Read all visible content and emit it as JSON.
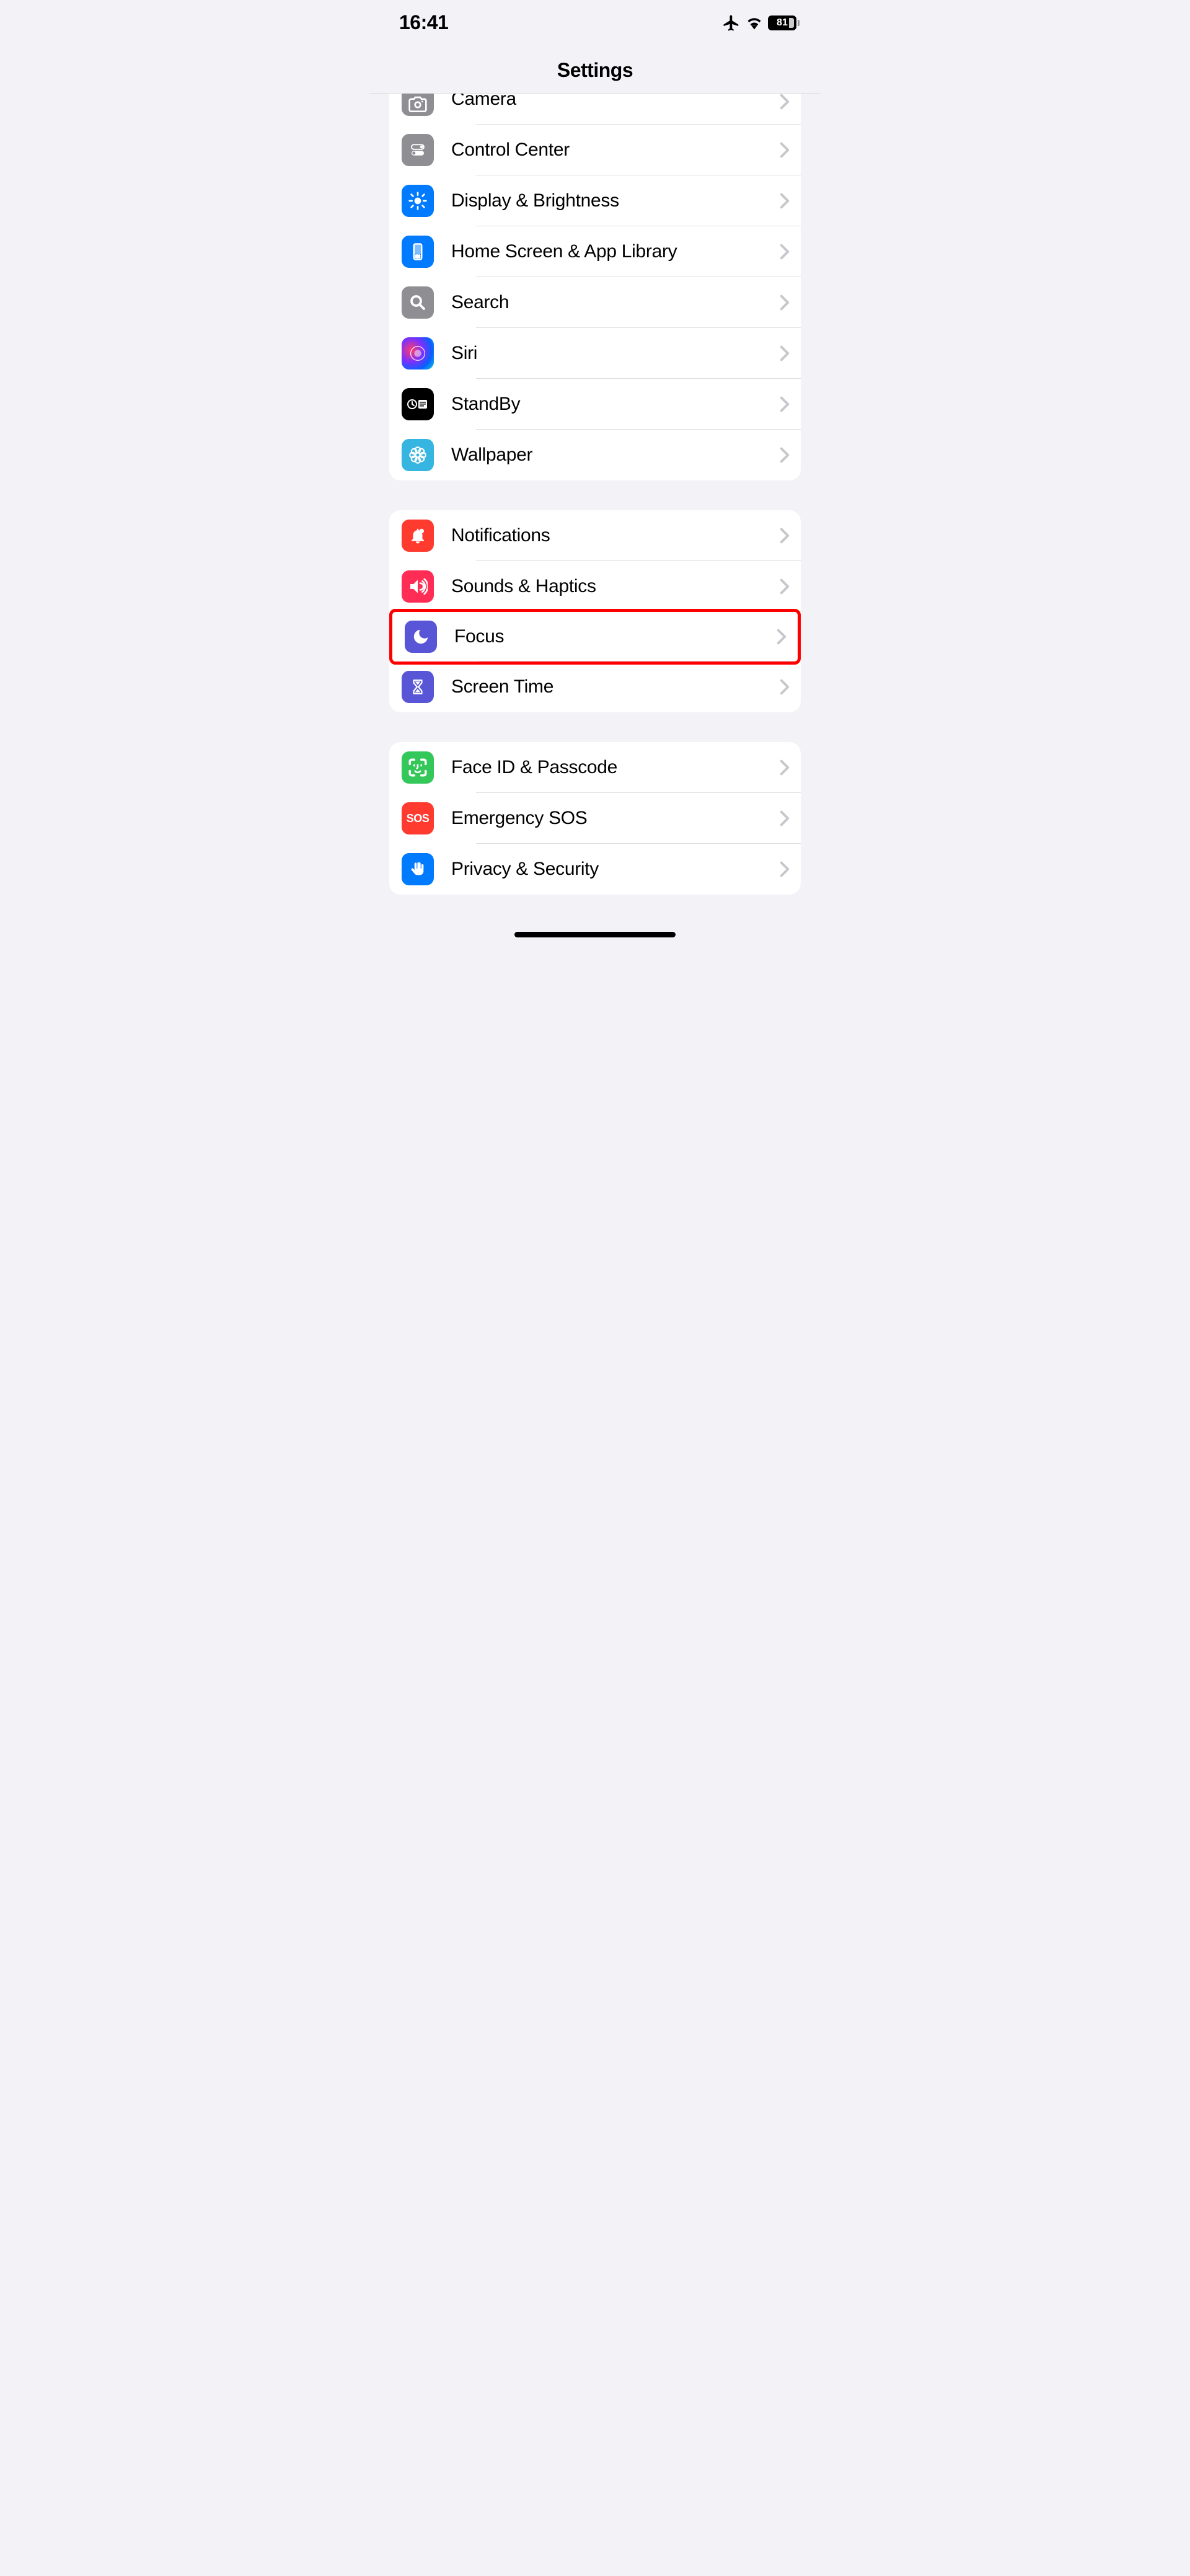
{
  "status": {
    "time": "16:41",
    "airplane": true,
    "battery": "81"
  },
  "header": {
    "title": "Settings"
  },
  "groups": [
    {
      "firstPartial": true,
      "items": [
        {
          "label": "Camera",
          "icon": "camera-icon",
          "color": "c-gray",
          "highlight": false
        },
        {
          "label": "Control Center",
          "icon": "switches-icon",
          "color": "c-gray",
          "highlight": false
        },
        {
          "label": "Display & Brightness",
          "icon": "sun-icon",
          "color": "c-blue",
          "highlight": false
        },
        {
          "label": "Home Screen & App Library",
          "icon": "phone-icon",
          "color": "c-blue",
          "highlight": false
        },
        {
          "label": "Search",
          "icon": "magnify-icon",
          "color": "c-gray2",
          "highlight": false
        },
        {
          "label": "Siri",
          "icon": "siri-icon",
          "color": "siri-bg",
          "highlight": false
        },
        {
          "label": "StandBy",
          "icon": "standby-icon",
          "color": "c-black",
          "highlight": false
        },
        {
          "label": "Wallpaper",
          "icon": "flower-icon",
          "color": "c-cyan",
          "highlight": false
        }
      ]
    },
    {
      "items": [
        {
          "label": "Notifications",
          "icon": "bell-icon",
          "color": "c-red",
          "highlight": false
        },
        {
          "label": "Sounds & Haptics",
          "icon": "speaker-icon",
          "color": "c-pink",
          "highlight": false
        },
        {
          "label": "Focus",
          "icon": "moon-icon",
          "color": "c-indigo",
          "highlight": true
        },
        {
          "label": "Screen Time",
          "icon": "hourglass-icon",
          "color": "c-indigo",
          "highlight": false
        }
      ]
    },
    {
      "items": [
        {
          "label": "Face ID & Passcode",
          "icon": "faceid-icon",
          "color": "c-green",
          "highlight": false
        },
        {
          "label": "Emergency SOS",
          "icon": "sos-icon",
          "color": "c-red",
          "highlight": false
        },
        {
          "label": "Privacy & Security",
          "icon": "hand-icon",
          "color": "c-blue",
          "highlight": false
        }
      ]
    }
  ]
}
